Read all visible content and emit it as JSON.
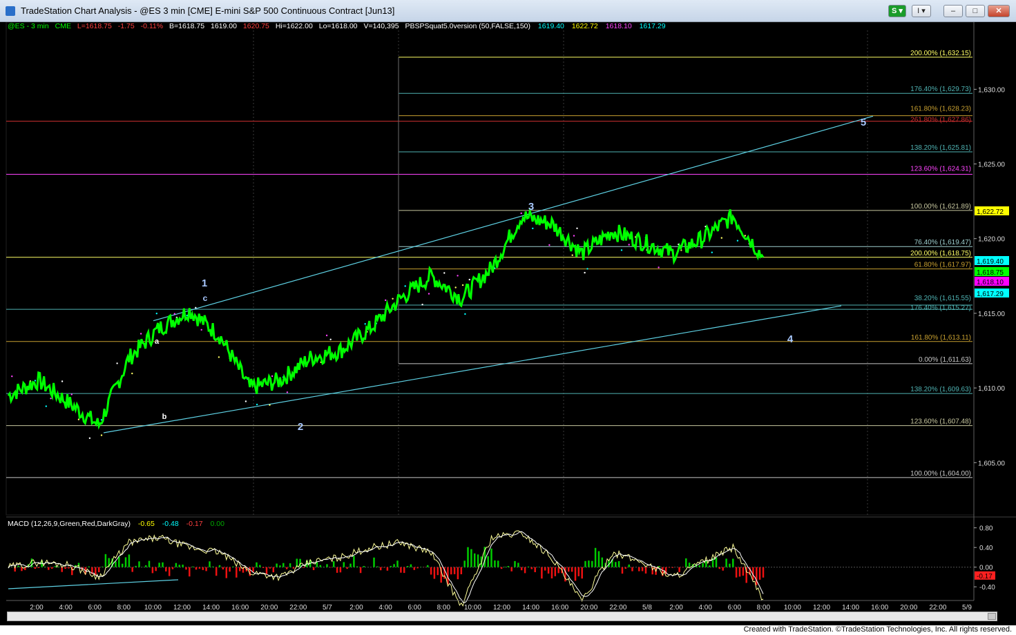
{
  "window": {
    "title": "TradeStation Chart Analysis - @ES 3 min [CME] E-mini S&P 500 Continuous Contract [Jun13]",
    "s_button": "S",
    "menu_button": "I",
    "min_label": "–",
    "max_label": "□",
    "close_label": "✕"
  },
  "status_line": {
    "symbol": "@ES - 3 min",
    "exchange": "CME",
    "last": "L=1618.75",
    "change": "-1.75",
    "pct": "-0.11%",
    "bid": "B=1618.75",
    "ask": "1619.00",
    "ask_alt": "1620.75",
    "hi": "Hi=1622.00",
    "lo": "Lo=1618.00",
    "vol": "V=140,395",
    "indicator": "PBSPSquat5.0version (50,FALSE,150)",
    "ind_v1": "1619.40",
    "ind_v2": "1622.72",
    "ind_v3": "1618.10",
    "ind_v4": "1617.29"
  },
  "macd": {
    "label": "MACD (12,26,9,Green,Red,DarkGray)",
    "v1": "-0.65",
    "v2": "-0.48",
    "v3": "-0.17",
    "v4": "0.00",
    "axis": [
      "0.80",
      "0.40",
      "0.00",
      "-0.40"
    ],
    "tag": "-0.17"
  },
  "price_axis": [
    "1,630.00",
    "1,625.00",
    "1,620.00",
    "1,615.00",
    "1,610.00",
    "1,605.00"
  ],
  "price_tags": [
    {
      "text": "1,622.72",
      "color": "#ffff00",
      "fg": "#000000"
    },
    {
      "text": "1,619.40",
      "color": "#00ffff",
      "fg": "#000000"
    },
    {
      "text": "1,618.75",
      "color": "#00ff00",
      "fg": "#000000"
    },
    {
      "text": "1,618.10",
      "color": "#ff00ff",
      "fg": "#000000"
    },
    {
      "text": "1,617.29",
      "color": "#00ffff",
      "fg": "#000000"
    }
  ],
  "fib_levels": [
    {
      "text": "200.00% (1,632.15)",
      "color": "#ffff66"
    },
    {
      "text": "176.40% (1,629.73)",
      "color": "#4fb3b3"
    },
    {
      "text": "161.80% (1,628.23)",
      "color": "#c8a030"
    },
    {
      "text": "261.80% (1,627.86)",
      "color": "#d03030"
    },
    {
      "text": "138.20% (1,625.81)",
      "color": "#4fb3b3"
    },
    {
      "text": "123.60% (1,624.31)",
      "color": "#ff44ff"
    },
    {
      "text": "100.00% (1,621.89)",
      "color": "#c8c8a0"
    },
    {
      "text": "76.40% (1,619.47)",
      "color": "#9fd0d0"
    },
    {
      "text": "200.00% (1,618.75)",
      "color": "#ffff66"
    },
    {
      "text": "61.80% (1,617.97)",
      "color": "#c8a030"
    },
    {
      "text": "38.20% (1,615.55)",
      "color": "#4fb3b3"
    },
    {
      "text": "176.40% (1,615.27)",
      "color": "#4fb3b3"
    },
    {
      "text": "161.80% (1,613.11)",
      "color": "#c8a030"
    },
    {
      "text": "0.00% (1,611.63)",
      "color": "#c8c8c8"
    },
    {
      "text": "138.20% (1,609.63)",
      "color": "#4fb3b3"
    },
    {
      "text": "123.60% (1,607.48)",
      "color": "#c8c8a0"
    },
    {
      "text": "100.00% (1,604.00)",
      "color": "#c8c8c8"
    }
  ],
  "wave_labels": [
    "1",
    "c",
    "a",
    "b",
    "2",
    "3",
    "4",
    "5"
  ],
  "time_axis": [
    "2:00",
    "4:00",
    "6:00",
    "8:00",
    "10:00",
    "12:00",
    "14:00",
    "16:00",
    "20:00",
    "22:00",
    "5/7",
    "2:00",
    "4:00",
    "6:00",
    "8:00",
    "10:00",
    "12:00",
    "14:00",
    "16:00",
    "20:00",
    "22:00",
    "5/8",
    "2:00",
    "4:00",
    "6:00",
    "8:00",
    "10:00",
    "12:00",
    "14:00",
    "16:00",
    "20:00",
    "22:00",
    "5/9"
  ],
  "footer": "Created with TradeStation. ©TradeStation Technologies, Inc. All rights reserved.",
  "chart_data": {
    "type": "line",
    "title": "@ES - 3 min",
    "ylabel": "",
    "ylim": [
      1601.5,
      1634.5
    ],
    "x": [
      "2:00",
      "4:00",
      "6:00",
      "8:00",
      "10:00",
      "12:00",
      "14:00",
      "16:00",
      "20:00",
      "22:00",
      "5/7",
      "2:00",
      "4:00",
      "6:00",
      "8:00",
      "10:00",
      "12:00",
      "14:00",
      "16:00",
      "20:00",
      "22:00",
      "5/8",
      "2:00",
      "4:00",
      "6:00",
      "8:00"
    ],
    "series": [
      {
        "name": "@ES",
        "values": [
          1609.5,
          1610.5,
          1609,
          1607.5,
          1612,
          1614,
          1615.2,
          1613.5,
          1610,
          1610.5,
          1612,
          1612.5,
          1614,
          1616,
          1617.5,
          1616,
          1618,
          1621.5,
          1621,
          1619,
          1620.5,
          1619.8,
          1619,
          1620,
          1621.5,
          1618.75
        ]
      }
    ],
    "macd_series": [
      {
        "name": "MACD",
        "values": [
          0.0,
          0.1,
          0.05,
          -0.2,
          0.5,
          0.6,
          0.4,
          0.3,
          -0.1,
          -0.2,
          0.1,
          0.2,
          0.4,
          0.5,
          0.3,
          -0.8,
          0.6,
          0.7,
          0.2,
          -0.7,
          0.3,
          0.1,
          -0.2,
          0.1,
          0.4,
          -0.65
        ]
      }
    ],
    "macd_ylim": [
      -0.65,
      0.95
    ]
  }
}
